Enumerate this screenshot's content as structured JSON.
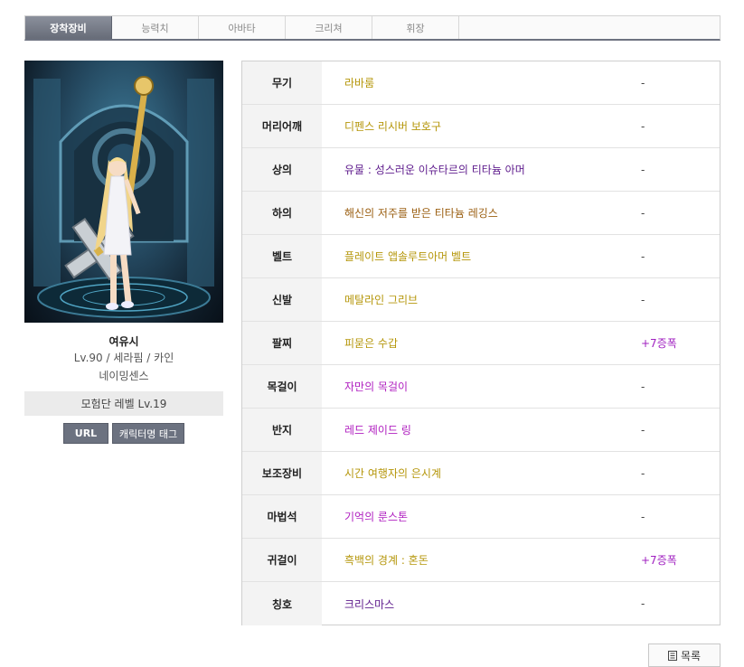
{
  "tabs": [
    "장착장비",
    "능력치",
    "아바타",
    "크리쳐",
    "휘장"
  ],
  "active_tab": 0,
  "character": {
    "name": "여유시",
    "level_line": "Lv.90 / 세라핌 / 카인",
    "guild": "네이밍센스",
    "adventure_level": "모험단 레벨 Lv.19"
  },
  "buttons": {
    "url": "URL",
    "tag": "캐릭터명 태그"
  },
  "equipment": [
    {
      "slot": "무기",
      "item": "라바룸",
      "color": "#b5960a",
      "extra": "-"
    },
    {
      "slot": "머리어깨",
      "item": "디펜스 리시버 보호구",
      "color": "#b5960a",
      "extra": "-"
    },
    {
      "slot": "상의",
      "item": "유물 : 성스러운 이슈타르의 티타늄 아머",
      "color": "#5d1a8c",
      "extra": "-"
    },
    {
      "slot": "하의",
      "item": "해신의 저주를 받은 티타늄 레깅스",
      "color": "#9a5e10",
      "extra": "-"
    },
    {
      "slot": "벨트",
      "item": "플레이트 앱솔루트아머 벨트",
      "color": "#b5960a",
      "extra": "-"
    },
    {
      "slot": "신발",
      "item": "메탈라인 그리브",
      "color": "#b5960a",
      "extra": "-"
    },
    {
      "slot": "팔찌",
      "item": "피묻은 수갑",
      "color": "#b5960a",
      "extra": "+7증폭",
      "extra_color": "#a020c0"
    },
    {
      "slot": "목걸이",
      "item": "자만의 목걸이",
      "color": "#b020c0",
      "extra": "-"
    },
    {
      "slot": "반지",
      "item": "레드 제이드 링",
      "color": "#b020c0",
      "extra": "-"
    },
    {
      "slot": "보조장비",
      "item": "시간 여행자의 은시계",
      "color": "#b5960a",
      "extra": "-"
    },
    {
      "slot": "마법석",
      "item": "기억의 룬스톤",
      "color": "#b020c0",
      "extra": "-"
    },
    {
      "slot": "귀걸이",
      "item": "흑백의 경계 : 혼돈",
      "color": "#b5960a",
      "extra": "+7증폭",
      "extra_color": "#a020c0"
    },
    {
      "slot": "칭호",
      "item": "크리스마스",
      "color": "#5d1a8c",
      "extra": "-"
    }
  ],
  "list_button": "목록"
}
